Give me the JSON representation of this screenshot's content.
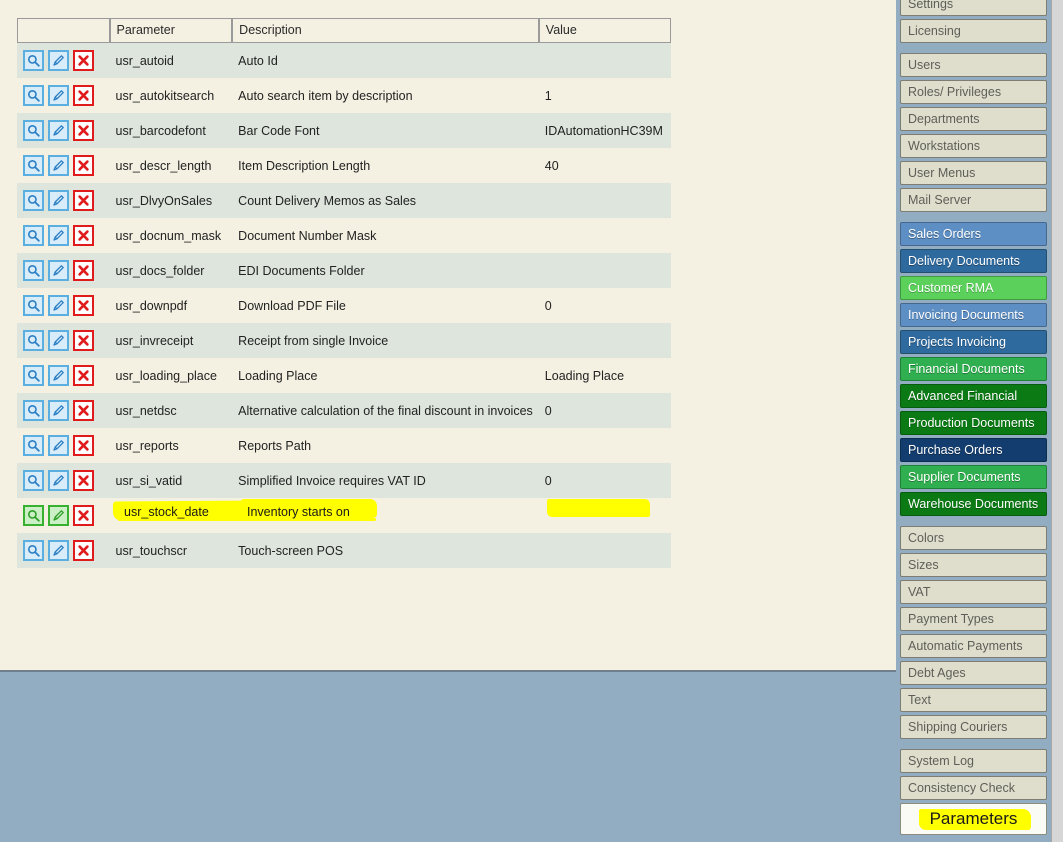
{
  "table": {
    "columns": {
      "actions": "",
      "parameter": "Parameter",
      "description": "Description",
      "value": "Value"
    },
    "rows": [
      {
        "parameter": "usr_autoid",
        "description": "Auto Id",
        "value": "",
        "highlighted": false
      },
      {
        "parameter": "usr_autokitsearch",
        "description": "Auto search item by description",
        "value": "1",
        "highlighted": false
      },
      {
        "parameter": "usr_barcodefont",
        "description": "Bar Code Font",
        "value": "IDAutomationHC39M",
        "highlighted": false
      },
      {
        "parameter": "usr_descr_length",
        "description": "Item Description Length",
        "value": "40",
        "highlighted": false
      },
      {
        "parameter": "usr_DlvyOnSales",
        "description": "Count Delivery Memos as Sales",
        "value": "",
        "highlighted": false
      },
      {
        "parameter": "usr_docnum_mask",
        "description": "Document Number Mask",
        "value": "",
        "highlighted": false
      },
      {
        "parameter": "usr_docs_folder",
        "description": "EDI Documents Folder",
        "value": "",
        "highlighted": false
      },
      {
        "parameter": "usr_downpdf",
        "description": "Download PDF File",
        "value": "0",
        "highlighted": false
      },
      {
        "parameter": "usr_invreceipt",
        "description": "Receipt from single Invoice",
        "value": "",
        "highlighted": false
      },
      {
        "parameter": "usr_loading_place",
        "description": "Loading Place",
        "value": "Loading Place",
        "highlighted": false
      },
      {
        "parameter": "usr_netdsc",
        "description": "Alternative calculation of the final discount in invoices",
        "value": "0",
        "highlighted": false
      },
      {
        "parameter": "usr_reports",
        "description": "Reports Path",
        "value": "",
        "highlighted": false
      },
      {
        "parameter": "usr_si_vatid",
        "description": "Simplified Invoice requires VAT ID",
        "value": "0",
        "highlighted": false
      },
      {
        "parameter": "usr_stock_date",
        "description": "Inventory starts on",
        "value": "",
        "highlighted": true
      },
      {
        "parameter": "usr_touchscr",
        "description": "Touch-screen POS",
        "value": "",
        "highlighted": false
      }
    ],
    "row_actions": {
      "view": "view-row",
      "edit": "edit-row",
      "delete": "delete-row"
    }
  },
  "sidebar": {
    "items": [
      {
        "label": "Settings",
        "style": "plain",
        "gap": false
      },
      {
        "label": "Licensing",
        "style": "plain",
        "gap": false
      },
      {
        "label": "Users",
        "style": "plain",
        "gap": true
      },
      {
        "label": "Roles/ Privileges",
        "style": "plain",
        "gap": false
      },
      {
        "label": "Departments",
        "style": "plain",
        "gap": false
      },
      {
        "label": "Workstations",
        "style": "plain",
        "gap": false
      },
      {
        "label": "User Menus",
        "style": "plain",
        "gap": false
      },
      {
        "label": "Mail Server",
        "style": "plain",
        "gap": false
      },
      {
        "label": "Sales Orders",
        "style": "c-blue-lt",
        "gap": true
      },
      {
        "label": "Delivery Documents",
        "style": "c-blue-md",
        "gap": false
      },
      {
        "label": "Customer RMA",
        "style": "c-green-lt",
        "gap": false
      },
      {
        "label": "Invoicing Documents",
        "style": "c-blue-lt",
        "gap": false
      },
      {
        "label": "Projects Invoicing",
        "style": "c-blue-md",
        "gap": false
      },
      {
        "label": "Financial Documents",
        "style": "c-green-md",
        "gap": false
      },
      {
        "label": "Advanced Financial",
        "style": "c-green-dk",
        "gap": false
      },
      {
        "label": "Production Documents",
        "style": "c-green-dk",
        "gap": false
      },
      {
        "label": "Purchase Orders",
        "style": "c-blue-dk",
        "gap": false
      },
      {
        "label": "Supplier Documents",
        "style": "c-green-md",
        "gap": false
      },
      {
        "label": "Warehouse Documents",
        "style": "c-green-dk",
        "gap": false
      },
      {
        "label": "Colors",
        "style": "plain",
        "gap": true
      },
      {
        "label": "Sizes",
        "style": "plain",
        "gap": false
      },
      {
        "label": "VAT",
        "style": "plain",
        "gap": false
      },
      {
        "label": "Payment Types",
        "style": "plain",
        "gap": false
      },
      {
        "label": "Automatic Payments",
        "style": "plain",
        "gap": false
      },
      {
        "label": "Debt Ages",
        "style": "plain",
        "gap": false
      },
      {
        "label": "Text",
        "style": "plain",
        "gap": false
      },
      {
        "label": "Shipping Couriers",
        "style": "plain",
        "gap": false
      },
      {
        "label": "System Log",
        "style": "plain",
        "gap": true
      },
      {
        "label": "Consistency Check",
        "style": "plain",
        "gap": false
      },
      {
        "label": "Parameters",
        "style": "active",
        "gap": false
      }
    ]
  },
  "annotations": {
    "highlight_color": "#FFFF00",
    "marked_parameter": "usr_stock_date",
    "marked_description": "Inventory starts on",
    "marked_menu_item": "Parameters"
  },
  "colors": {
    "page_background": "#92ADC2",
    "content_background": "#F4F1E2",
    "row_alt_background": "#DDE5DD",
    "highlight": "#FFFF00"
  }
}
